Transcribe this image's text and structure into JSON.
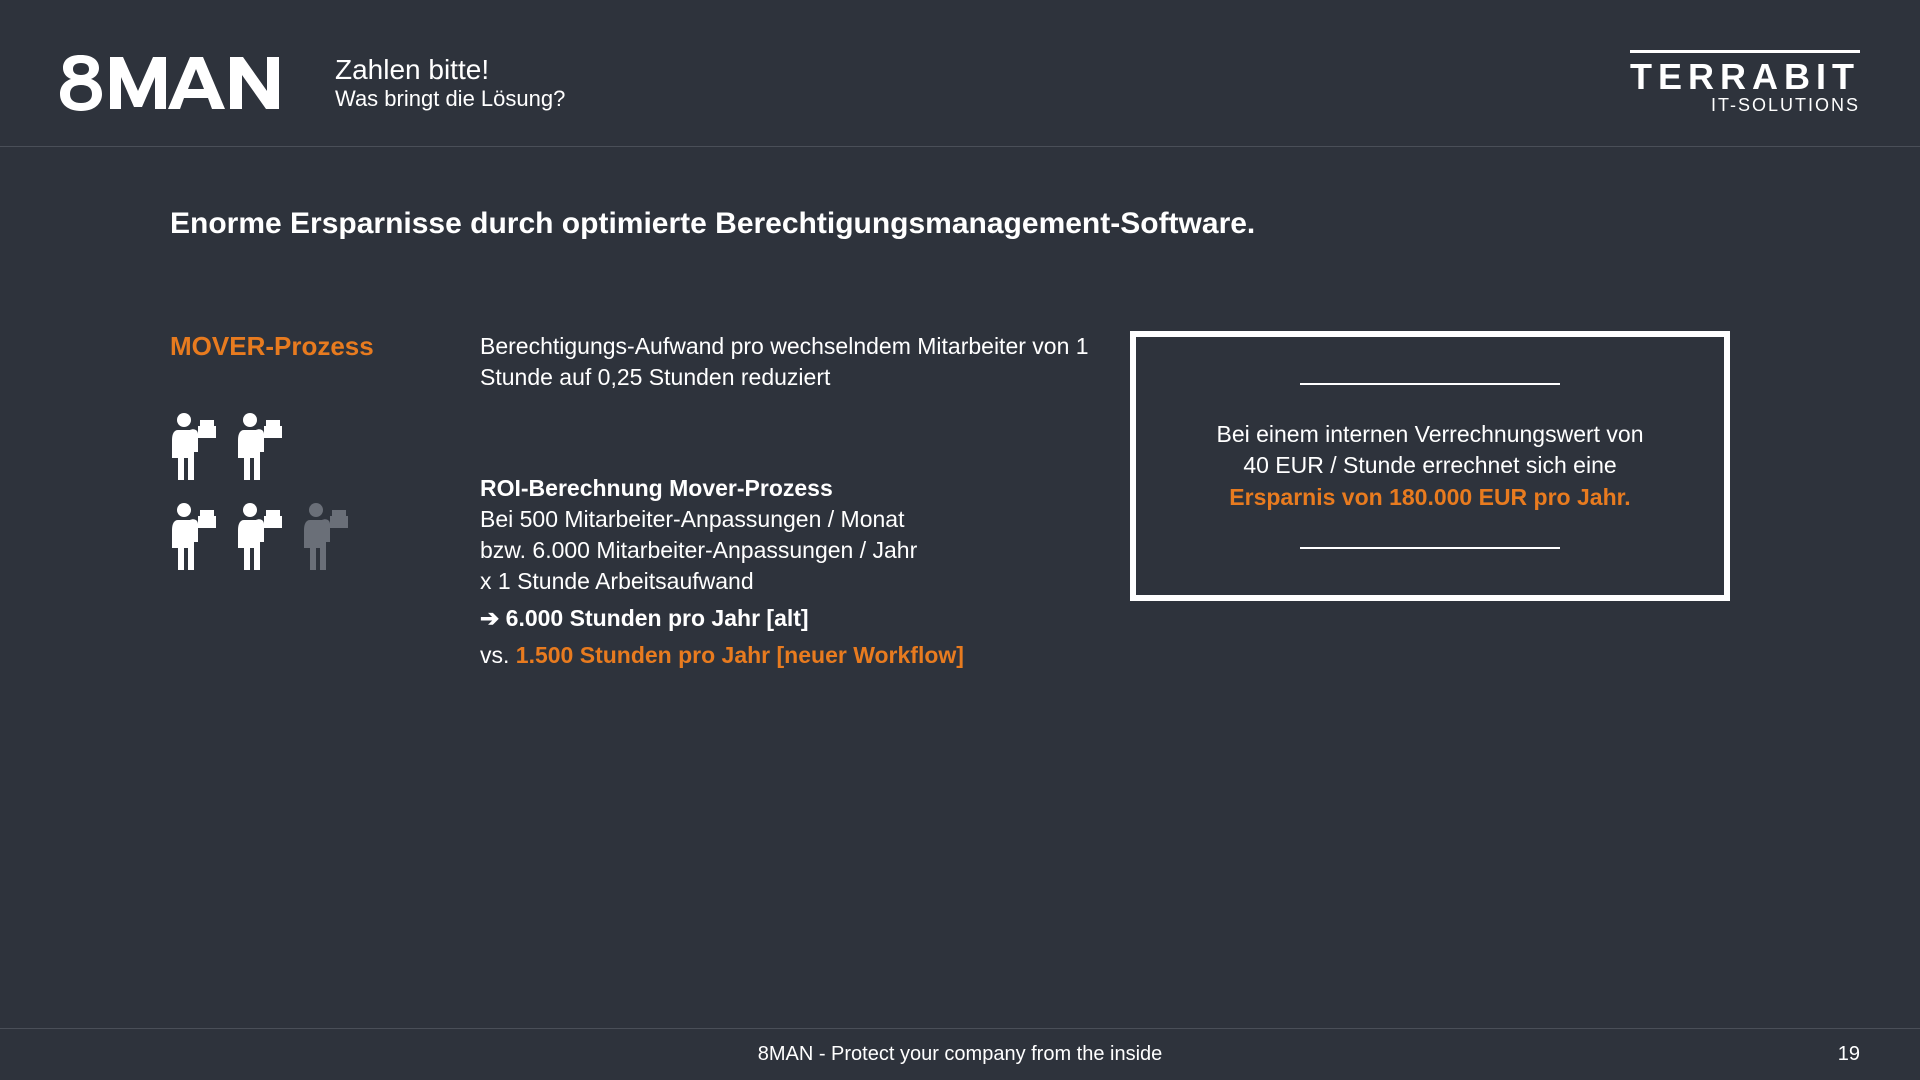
{
  "header": {
    "logo_text": "8MAN",
    "title": "Zahlen bitte!",
    "subtitle": "Was bringt die Lösung?",
    "terrabit_main": "TERRABIT",
    "terrabit_sub": "IT-SOLUTIONS"
  },
  "content": {
    "headline": "Enorme Ersparnisse durch optimierte Berechtigungsmanagement-Software.",
    "process_title": "MOVER-Prozess",
    "intro": "Berechtigungs-Aufwand pro wechselndem Mitarbeiter von 1 Stunde auf 0,25 Stunden reduziert",
    "roi_heading": "ROI-Berechnung Mover-Prozess",
    "line1": "Bei 500 Mitarbeiter-Anpassungen / Monat",
    "line2": "bzw. 6.000 Mitarbeiter-Anpassungen / Jahr",
    "line3": "x 1 Stunde Arbeitsaufwand",
    "result_old_arrow": "➔",
    "result_old": "6.000 Stunden pro Jahr [alt]",
    "vs_label": "vs.",
    "result_new": "1.500 Stunden pro Jahr [neuer Workflow]",
    "callout_line1": "Bei einem internen Verrechnungswert von",
    "callout_line2": "40 EUR / Stunde errechnet sich eine",
    "callout_highlight": "Ersparnis von 180.000 EUR pro Jahr."
  },
  "footer": {
    "text": "8MAN - Protect your company from the inside",
    "page": "19"
  },
  "colors": {
    "background": "#2e333c",
    "accent": "#e87b1f",
    "text": "#ffffff",
    "muted_icon": "#6a6f78"
  }
}
